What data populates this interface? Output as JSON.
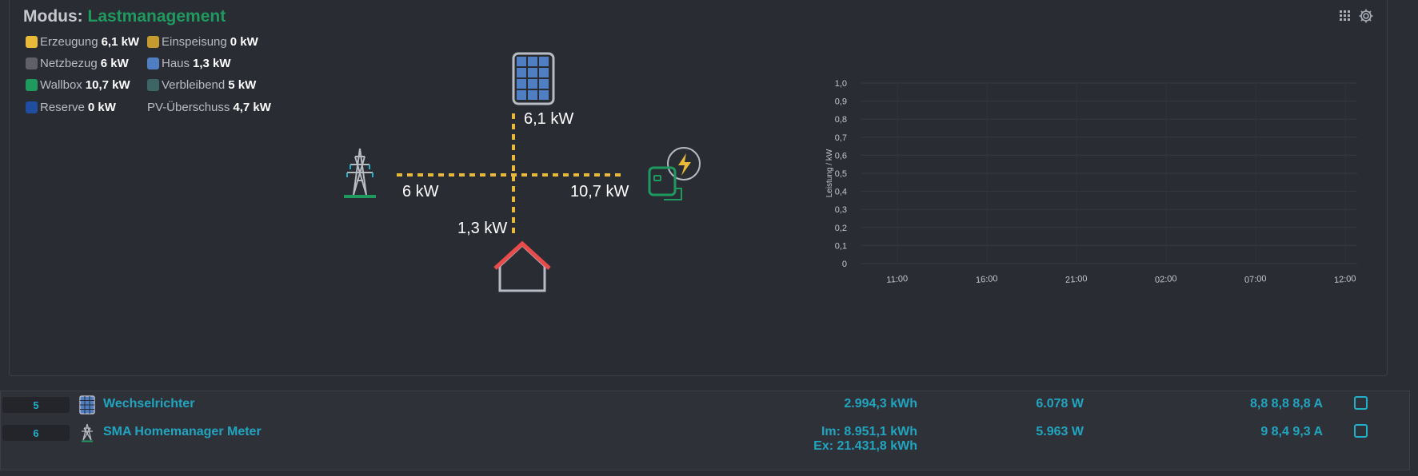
{
  "header": {
    "label": "Modus:",
    "mode": "Lastmanagement"
  },
  "icons": {
    "grid_view": "grid-view-icon",
    "settings": "gear-icon"
  },
  "legend": [
    {
      "label": "Erzeugung",
      "value": "6,1 kW",
      "color": "#e9b93a"
    },
    {
      "label": "Einspeisung",
      "value": "0 kW",
      "color": "#c59a2e"
    },
    {
      "label": "Netzbezug",
      "value": "6 kW",
      "color": "#5f6068"
    },
    {
      "label": "Haus",
      "value": "1,3 kW",
      "color": "#4f7ec2"
    },
    {
      "label": "Wallbox",
      "value": "10,7 kW",
      "color": "#1f9a5f"
    },
    {
      "label": "Verbleibend",
      "value": "5 kW",
      "color": "#3e6566"
    },
    {
      "label": "Reserve",
      "value": "0 kW",
      "color": "#1f4ea0"
    },
    {
      "label": "PV-Überschuss",
      "value": "4,7 kW",
      "color": ""
    }
  ],
  "flow": {
    "pv": "6,1 kW",
    "grid": "6 kW",
    "wallbox": "10,7 kW",
    "house": "1,3 kW",
    "line_color": "#e9b93a"
  },
  "chart_data": {
    "type": "line",
    "ylabel": "Leistung / kW",
    "ylim": [
      0,
      1
    ],
    "y_ticks": [
      "1,0",
      "0,9",
      "0,8",
      "0,7",
      "0,6",
      "0,5",
      "0,4",
      "0,3",
      "0,2",
      "0,1",
      "0"
    ],
    "x_ticks": [
      "11:00",
      "16:00",
      "21:00",
      "02:00",
      "07:00",
      "12:00"
    ],
    "grid": true,
    "series": []
  },
  "devices": [
    {
      "id": "5",
      "icon": "solar-panel-icon",
      "name": "Wechselrichter",
      "energy": [
        "2.994,3 kWh"
      ],
      "power": "6.078 W",
      "current": "8,8 8,8 8,8 A"
    },
    {
      "id": "6",
      "icon": "power-pylon-icon",
      "name": "SMA Homemanager Meter",
      "energy": [
        "Im: 8.951,1 kWh",
        "Ex: 21.431,8 kWh"
      ],
      "power": "5.963 W",
      "current": "9 8,4 9,3 A"
    }
  ]
}
